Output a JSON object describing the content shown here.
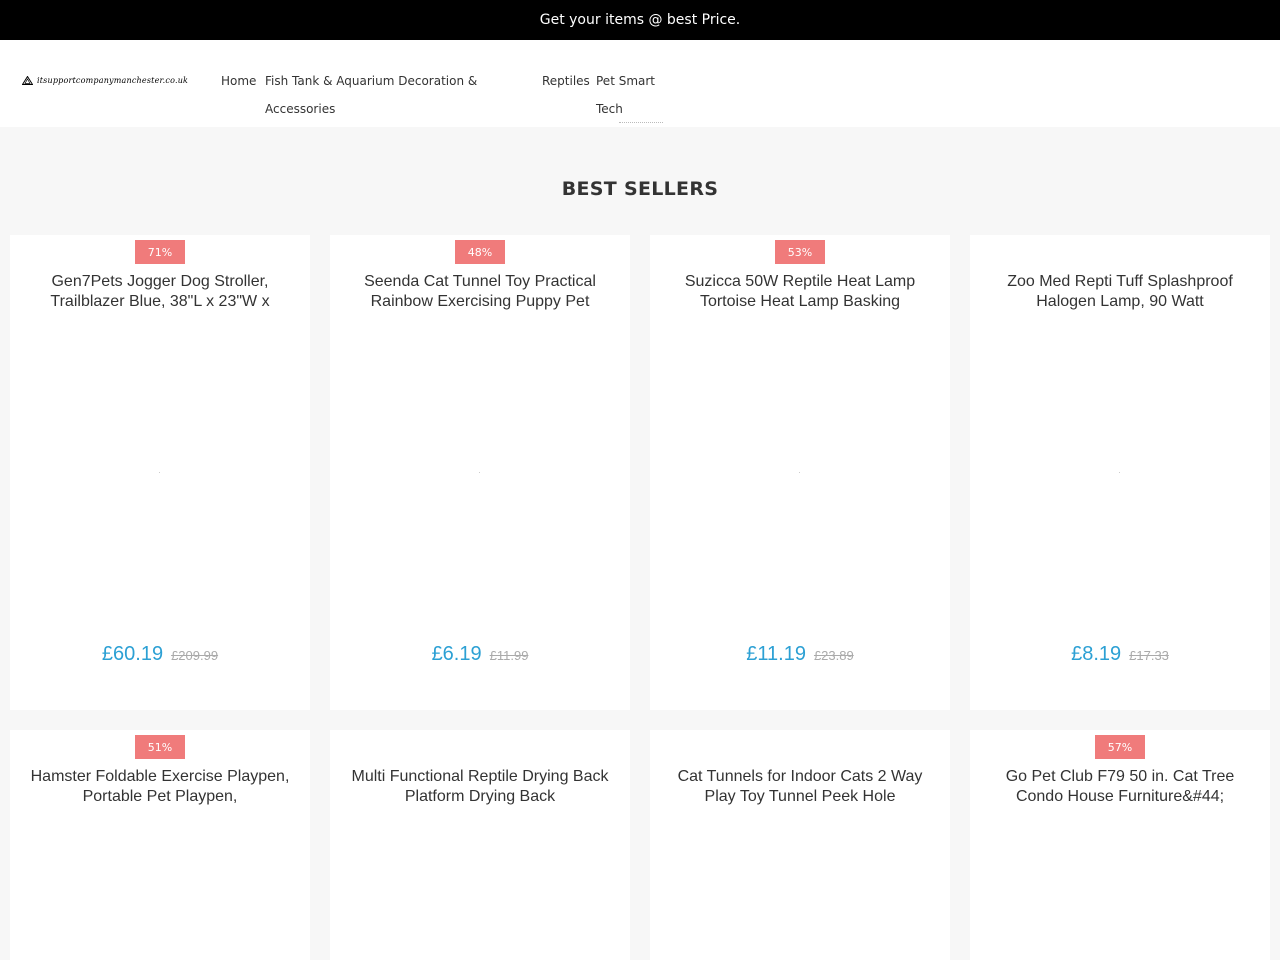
{
  "topbar": {
    "message": "Get your items @ best Price."
  },
  "header": {
    "logo_text": "itsupportcompanymanchester.co.uk",
    "nav": [
      {
        "label": "Home"
      },
      {
        "label": "Fish Tank & Aquarium Decoration & Accessories"
      },
      {
        "label": "Reptiles"
      },
      {
        "label": "Pet Smart Tech"
      }
    ]
  },
  "section": {
    "title": "BEST SELLERS"
  },
  "products": [
    {
      "badge": "71%",
      "title": "Gen7Pets Jogger Dog Stroller, Trailblazer Blue, 38\"L x 23\"W x",
      "price": "£60.19",
      "old_price": "£209.99"
    },
    {
      "badge": "48%",
      "title": "Seenda Cat Tunnel Toy Practical Rainbow Exercising Puppy Pet",
      "price": "£6.19",
      "old_price": "£11.99"
    },
    {
      "badge": "53%",
      "title": "Suzicca 50W Reptile Heat Lamp Tortoise Heat Lamp Basking",
      "price": "£11.19",
      "old_price": "£23.89"
    },
    {
      "badge": "",
      "title": "Zoo Med Repti Tuff Splashproof Halogen Lamp, 90 Watt",
      "price": "£8.19",
      "old_price": "£17.33"
    },
    {
      "badge": "51%",
      "title": "Hamster Foldable Exercise Playpen, Portable Pet Playpen,",
      "price": "",
      "old_price": ""
    },
    {
      "badge": "",
      "title": "Multi Functional Reptile Drying Back Platform Drying Back",
      "price": "",
      "old_price": ""
    },
    {
      "badge": "",
      "title": "Cat Tunnels for Indoor Cats 2 Way Play Toy Tunnel Peek Hole",
      "price": "",
      "old_price": ""
    },
    {
      "badge": "57%",
      "title": "Go Pet Club F79 50 in. Cat Tree Condo House Furniture&#44;",
      "price": "",
      "old_price": ""
    }
  ],
  "colors": {
    "badge": "#f07b7b",
    "price": "#2ca0d4",
    "topbar": "#000000"
  }
}
